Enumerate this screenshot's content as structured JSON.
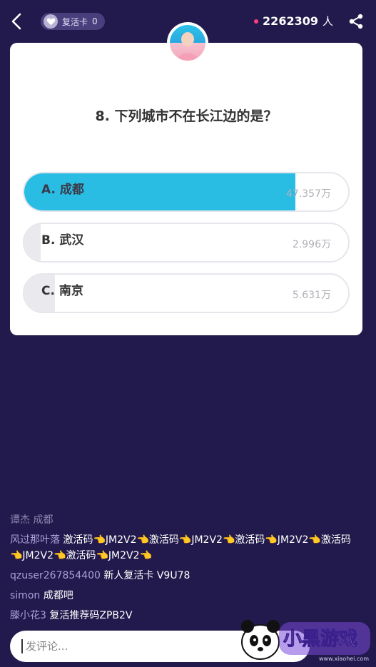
{
  "topbar": {
    "revive_label": "复活卡",
    "revive_count": "0",
    "viewer_count": "2262309",
    "viewer_unit": "人"
  },
  "question": {
    "text": "8. 下列城市不在长江边的是？",
    "options": [
      {
        "label": "A. 成都",
        "count": "47.357万",
        "ratio": 0.837,
        "correct": true
      },
      {
        "label": "B. 武汉",
        "count": "2.996万",
        "ratio": 0.05,
        "correct": false
      },
      {
        "label": "C. 南京",
        "count": "5.631万",
        "ratio": 0.095,
        "correct": false
      }
    ]
  },
  "comments": [
    {
      "user": "谭杰",
      "text": "成都",
      "faded": true
    },
    {
      "user": "风过那叶落",
      "text": "激活码👈JM2V2👈激活码👈JM2V2👈激活码👈JM2V2👈激活码👈JM2V2👈激活码👈JM2V2👈"
    },
    {
      "user": "qzuser267854400",
      "text": "新人复活卡  V9U78"
    },
    {
      "user": "simon",
      "text": "成都吧"
    },
    {
      "user": "滕小花3",
      "text": "复活推荐码ZPB2V"
    }
  ],
  "input": {
    "placeholder": "发评论..."
  },
  "watermark": {
    "brand": "小黑游戏",
    "url": "www.xiaohei.com"
  },
  "colors": {
    "background": "#221a4c",
    "accent": "#29bde3",
    "live_dot": "#ff3f7e"
  }
}
